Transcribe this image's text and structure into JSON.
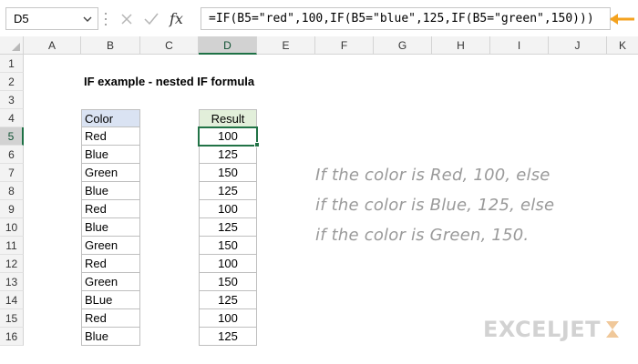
{
  "formula_bar": {
    "name_box": "D5",
    "fx_label": "fx",
    "formula": "=IF(B5=\"red\",100,IF(B5=\"blue\",125,IF(B5=\"green\",150)))"
  },
  "columns": [
    "A",
    "B",
    "C",
    "D",
    "E",
    "F",
    "G",
    "H",
    "I",
    "J",
    "K"
  ],
  "rows": [
    "1",
    "2",
    "3",
    "4",
    "5",
    "6",
    "7",
    "8",
    "9",
    "10",
    "11",
    "12",
    "13",
    "14",
    "15",
    "16"
  ],
  "sheet": {
    "title": "IF example - nested IF formula",
    "color_header": "Color",
    "result_header": "Result",
    "data": [
      {
        "color": "Red",
        "result": "100"
      },
      {
        "color": "Blue",
        "result": "125"
      },
      {
        "color": "Green",
        "result": "150"
      },
      {
        "color": "Blue",
        "result": "125"
      },
      {
        "color": "Red",
        "result": "100"
      },
      {
        "color": "Blue",
        "result": "125"
      },
      {
        "color": "Green",
        "result": "150"
      },
      {
        "color": "Red",
        "result": "100"
      },
      {
        "color": "Green",
        "result": "150"
      },
      {
        "color": "BLue",
        "result": "125"
      },
      {
        "color": "Red",
        "result": "100"
      },
      {
        "color": "Blue",
        "result": "125"
      }
    ]
  },
  "notes": [
    "If the color is Red, 100, else",
    "if the color is Blue, 125, else",
    "if the color is Green, 150."
  ],
  "logo": {
    "text": "EXCELJET"
  },
  "colors": {
    "accent": "#217346",
    "arrow": "#f4a21f",
    "color_header_bg": "#dae3f3",
    "result_header_bg": "#e2efda",
    "note_text": "#9a9a9a",
    "logo": "#d2d2d2"
  }
}
